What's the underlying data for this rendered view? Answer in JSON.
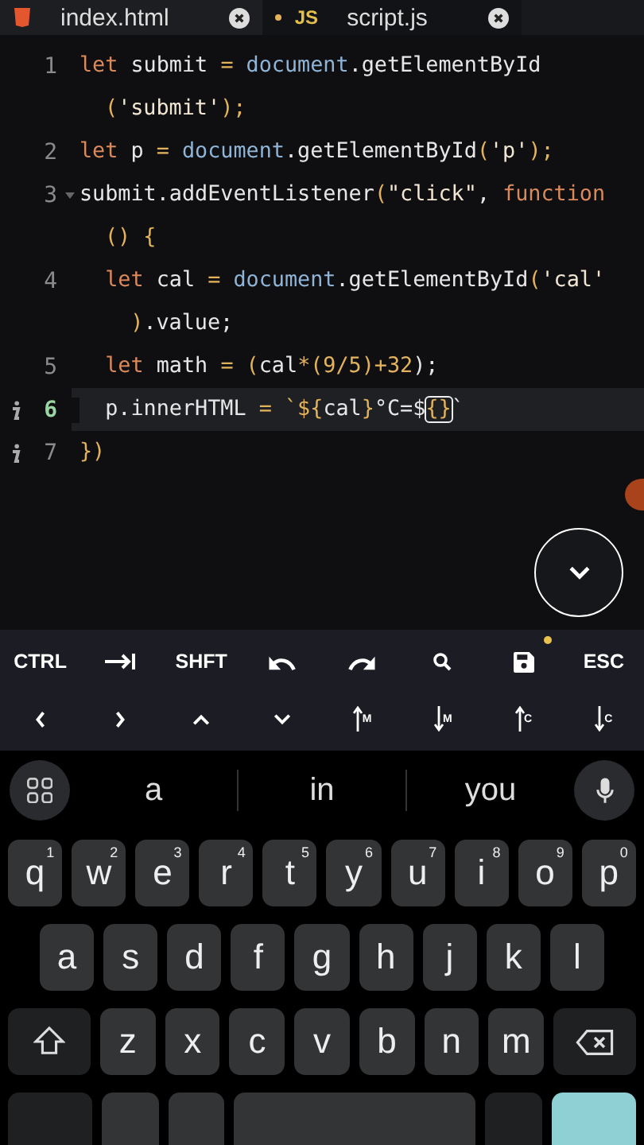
{
  "tabs": [
    {
      "label": "index.html",
      "kind": "html",
      "selected": false,
      "unsaved": false
    },
    {
      "label": "script.js",
      "kind": "js",
      "badge": "JS",
      "selected": true,
      "unsaved": true
    }
  ],
  "editor": {
    "lines": [
      {
        "number": "1",
        "active": false,
        "info": false,
        "foldable": false,
        "rows": [
          [
            {
              "t": "let",
              "kind": "kw"
            },
            {
              "t": " submit ",
              "kind": "id"
            },
            {
              "t": "=",
              "kind": "op"
            },
            {
              "t": " document",
              "kind": "obj"
            },
            {
              "t": ".getElementById",
              "kind": "id"
            }
          ],
          [
            {
              "t": "(",
              "kind": "op"
            },
            {
              "t": "'submit'",
              "kind": "str"
            },
            {
              "t": ");",
              "kind": "op"
            }
          ]
        ]
      },
      {
        "number": "2",
        "active": false,
        "info": false,
        "foldable": false,
        "rows": [
          [
            {
              "t": "let",
              "kind": "kw"
            },
            {
              "t": " p ",
              "kind": "id"
            },
            {
              "t": "=",
              "kind": "op"
            },
            {
              "t": " document",
              "kind": "obj"
            },
            {
              "t": ".getElementById",
              "kind": "id"
            },
            {
              "t": "(",
              "kind": "op"
            },
            {
              "t": "'p'",
              "kind": "str"
            },
            {
              "t": ");",
              "kind": "op"
            }
          ]
        ]
      },
      {
        "number": "3",
        "active": false,
        "info": false,
        "foldable": true,
        "rows": [
          [
            {
              "t": "submit.addEventListener",
              "kind": "id"
            },
            {
              "t": "(",
              "kind": "op"
            },
            {
              "t": "\"click\"",
              "kind": "str"
            },
            {
              "t": ", ",
              "kind": "id"
            },
            {
              "t": "function",
              "kind": "kw"
            }
          ],
          [
            {
              "t": "() {",
              "kind": "op"
            }
          ]
        ]
      },
      {
        "number": "4",
        "active": false,
        "info": false,
        "foldable": false,
        "rows": [
          [
            {
              "t": "  let",
              "kind": "kw"
            },
            {
              "t": " cal ",
              "kind": "id"
            },
            {
              "t": "=",
              "kind": "op"
            },
            {
              "t": " document",
              "kind": "obj"
            },
            {
              "t": ".getElementById",
              "kind": "id"
            },
            {
              "t": "(",
              "kind": "op"
            },
            {
              "t": "'cal'",
              "kind": "str"
            }
          ],
          [
            {
              "t": "  )",
              "kind": "op"
            },
            {
              "t": ".value;",
              "kind": "id"
            }
          ]
        ]
      },
      {
        "number": "5",
        "active": false,
        "info": false,
        "foldable": false,
        "rows": [
          [
            {
              "t": "  let",
              "kind": "kw"
            },
            {
              "t": " math ",
              "kind": "id"
            },
            {
              "t": "=",
              "kind": "op"
            },
            {
              "t": " (",
              "kind": "op"
            },
            {
              "t": "cal",
              "kind": "id"
            },
            {
              "t": "*(9/5)+32",
              "kind": "op"
            },
            {
              "t": ");",
              "kind": "id"
            }
          ]
        ]
      },
      {
        "number": "6",
        "active": true,
        "info": true,
        "foldable": false,
        "rows": [
          [
            {
              "t": "  p.innerHTML ",
              "kind": "id"
            },
            {
              "t": "=",
              "kind": "op"
            },
            {
              "t": " `${",
              "kind": "op"
            },
            {
              "t": "cal",
              "kind": "id"
            },
            {
              "t": "}",
              "kind": "op"
            },
            {
              "t": "°C=$",
              "kind": "id"
            },
            {
              "t": "{}",
              "kind": "cursor"
            },
            {
              "t": "`",
              "kind": "id"
            }
          ]
        ]
      },
      {
        "number": "7",
        "active": false,
        "info": true,
        "foldable": false,
        "rows": [
          [
            {
              "t": "})",
              "kind": "op"
            }
          ]
        ]
      }
    ]
  },
  "extra_keys": [
    [
      {
        "kind": "text",
        "label": "CTRL"
      },
      {
        "kind": "tab"
      },
      {
        "kind": "text",
        "label": "SHFT"
      },
      {
        "kind": "undo"
      },
      {
        "kind": "redo"
      },
      {
        "kind": "search"
      },
      {
        "kind": "save",
        "unsaved": true
      },
      {
        "kind": "text",
        "label": "ESC"
      }
    ],
    [
      {
        "kind": "left"
      },
      {
        "kind": "right"
      },
      {
        "kind": "up"
      },
      {
        "kind": "down"
      },
      {
        "kind": "jump-up",
        "label": "M"
      },
      {
        "kind": "jump-down",
        "label": "M"
      },
      {
        "kind": "jump-up",
        "label": "C"
      },
      {
        "kind": "jump-down",
        "label": "C"
      }
    ]
  ],
  "keyboard": {
    "suggestions": [
      "a",
      "in",
      "you"
    ],
    "rows": [
      [
        {
          "key": "q",
          "hint": "1"
        },
        {
          "key": "w",
          "hint": "2"
        },
        {
          "key": "e",
          "hint": "3"
        },
        {
          "key": "r",
          "hint": "4"
        },
        {
          "key": "t",
          "hint": "5"
        },
        {
          "key": "y",
          "hint": "6"
        },
        {
          "key": "u",
          "hint": "7"
        },
        {
          "key": "i",
          "hint": "8"
        },
        {
          "key": "o",
          "hint": "9"
        },
        {
          "key": "p",
          "hint": "0"
        }
      ],
      [
        {
          "key": "a"
        },
        {
          "key": "s"
        },
        {
          "key": "d"
        },
        {
          "key": "f"
        },
        {
          "key": "g"
        },
        {
          "key": "h"
        },
        {
          "key": "j"
        },
        {
          "key": "k"
        },
        {
          "key": "l"
        }
      ],
      [
        {
          "key": "z"
        },
        {
          "key": "x"
        },
        {
          "key": "c"
        },
        {
          "key": "v"
        },
        {
          "key": "b"
        },
        {
          "key": "n"
        },
        {
          "key": "m"
        }
      ]
    ]
  }
}
